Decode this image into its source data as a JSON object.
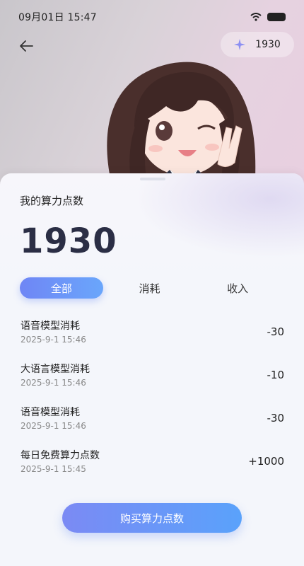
{
  "status_bar": {
    "time": "09月01日  15:47"
  },
  "header": {
    "points": "1930"
  },
  "card": {
    "title": "我的算力点数",
    "total": "1930",
    "tabs": [
      {
        "label": "全部",
        "active": true
      },
      {
        "label": "消耗",
        "active": false
      },
      {
        "label": "收入",
        "active": false
      }
    ],
    "records": [
      {
        "title": "语音模型消耗",
        "time": "2025-9-1 15:46",
        "amount": "-30"
      },
      {
        "title": "大语言模型消耗",
        "time": "2025-9-1 15:46",
        "amount": "-10"
      },
      {
        "title": "语音模型消耗",
        "time": "2025-9-1 15:46",
        "amount": "-30"
      },
      {
        "title": "每日免费算力点数",
        "time": "2025-9-1 15:45",
        "amount": "+1000"
      }
    ],
    "buy_label": "购买算力点数"
  },
  "colors": {
    "accent_start": "#6f86f5",
    "accent_end": "#5aa2fb",
    "number": "#2b2e45"
  }
}
